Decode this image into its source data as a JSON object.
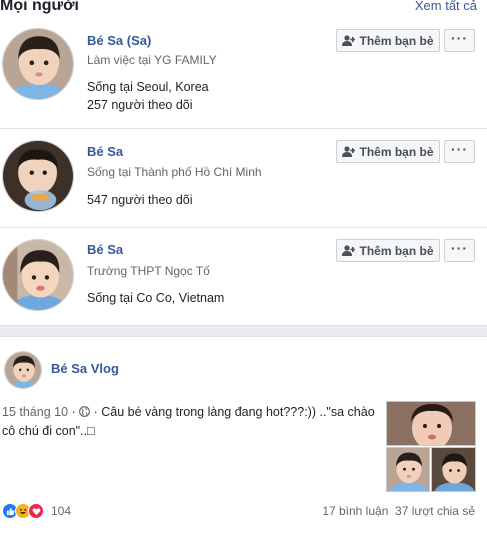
{
  "people": {
    "title": "Mọi người",
    "see_all": "Xem tất cả",
    "add_friend_label": "Thêm bạn bè",
    "items": [
      {
        "name": "Bé Sa (Sa)",
        "subtitle": "Làm việc tại YG FAMILY",
        "info1": "Sống tại Seoul, Korea",
        "info2": "257 người theo dõi"
      },
      {
        "name": "Bé Sa",
        "subtitle": "Sống tại Thành phố Hồ Chí Minh",
        "info1": "547 người theo dõi"
      },
      {
        "name": "Bé Sa",
        "subtitle": "Trường THPT Ngọc Tố",
        "info1": "Sống tại Co Co, Vietnam"
      }
    ]
  },
  "post": {
    "author": "Bé Sa Vlog",
    "date": "15 tháng 10",
    "separator": " · ",
    "text": " · Câu bé vàng trong làng đang hot???:)) ..\"sa chào cô chú đi con\"..□",
    "reaction_count": "104",
    "comments": "17 bình luận",
    "shares": "37 lượt chia sẻ"
  },
  "colors": {
    "link": "#365899",
    "like": "#2078f4",
    "haha": "#f7b125",
    "love": "#f0284a"
  },
  "icons": [
    "add-friend-icon",
    "more-icon",
    "globe-icon",
    "like-reaction-icon",
    "haha-reaction-icon",
    "love-reaction-icon"
  ]
}
